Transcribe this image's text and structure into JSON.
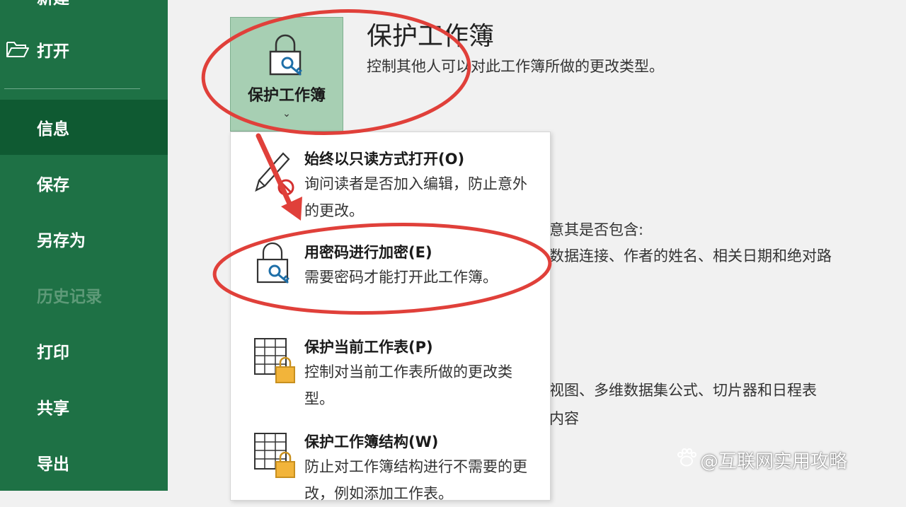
{
  "sidebar": {
    "items": [
      {
        "label": "新建"
      },
      {
        "label": "打开"
      },
      {
        "label": "信息"
      },
      {
        "label": "保存"
      },
      {
        "label": "另存为"
      },
      {
        "label": "历史记录"
      },
      {
        "label": "打印"
      },
      {
        "label": "共享"
      },
      {
        "label": "导出"
      }
    ]
  },
  "protect": {
    "tile_label": "保护工作簿",
    "chevron": "⌄",
    "title": "保护工作簿",
    "description": "控制其他人可以对此工作簿所做的更改类型。"
  },
  "background_text": {
    "line1": "意其是否包含:",
    "line2": "数据连接、作者的姓名、相关日期和绝对路",
    "line3": "视图、多维数据集公式、切片器和日程表",
    "line4": "内容"
  },
  "menu": {
    "items": [
      {
        "title": "始终以只读方式打开(O)",
        "desc": "询问读者是否加入编辑，防止意外的更改。",
        "icon": "pencil-no-icon"
      },
      {
        "title": "用密码进行加密(E)",
        "desc": "需要密码才能打开此工作簿。",
        "icon": "lock-key-icon"
      },
      {
        "title": "保护当前工作表(P)",
        "desc": "控制对当前工作表所做的更改类型。",
        "icon": "sheet-lock-icon"
      },
      {
        "title": "保护工作簿结构(W)",
        "desc": "防止对工作簿结构进行不需要的更改，例如添加工作表。",
        "icon": "sheet-lock-icon"
      }
    ]
  },
  "watermark": "@互联网实用攻略",
  "colors": {
    "sidebar": "#1e7145",
    "sidebar_active": "#0f5a32",
    "tile": "#a7cfb3",
    "annotation": "#e0403a"
  }
}
